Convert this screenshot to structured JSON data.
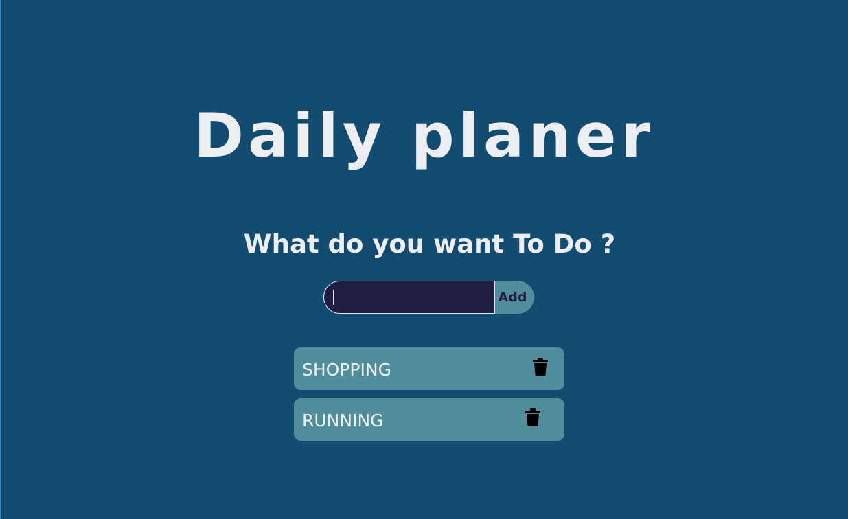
{
  "header": {
    "title": "Daily planer",
    "subtitle": "What do you want To Do ?"
  },
  "form": {
    "input_value": "",
    "input_placeholder": "",
    "add_label": "Add"
  },
  "todos": [
    {
      "label": "SHOPPING",
      "icon": "trash-icon"
    },
    {
      "label": "RUNNING",
      "icon": "trash-icon"
    }
  ],
  "colors": {
    "background": "#144b70",
    "accent": "#528d9b",
    "input_bg": "#211e44",
    "text": "#eceef2"
  }
}
